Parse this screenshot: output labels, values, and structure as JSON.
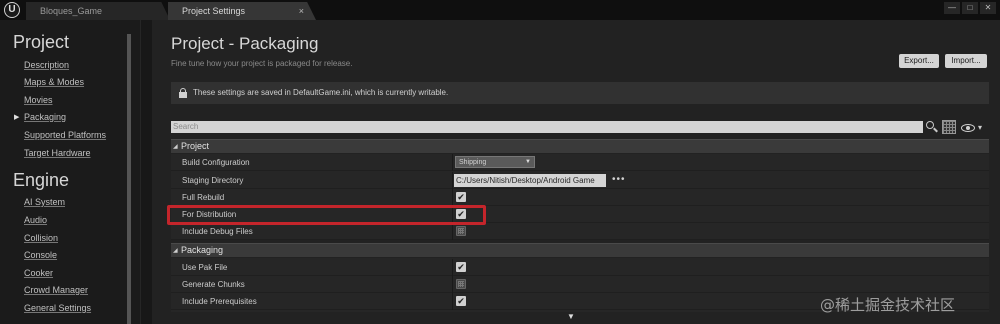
{
  "window": {
    "logo": "U",
    "tabs": [
      {
        "label": "Bloques_Game"
      },
      {
        "label": "Project Settings",
        "close": "×"
      }
    ],
    "controls": {
      "minimize": "—",
      "maximize": "□",
      "close": "✕"
    }
  },
  "sidebar": {
    "project_title": "Project",
    "project_items": [
      {
        "label": "Description"
      },
      {
        "label": "Maps & Modes"
      },
      {
        "label": "Movies"
      },
      {
        "label": "Packaging",
        "selected_marker": "▶"
      },
      {
        "label": "Supported Platforms"
      },
      {
        "label": "Target Hardware"
      }
    ],
    "engine_title": "Engine",
    "engine_items": [
      {
        "label": "AI System"
      },
      {
        "label": "Audio"
      },
      {
        "label": "Collision"
      },
      {
        "label": "Console"
      },
      {
        "label": "Cooker"
      },
      {
        "label": "Crowd Manager"
      },
      {
        "label": "General Settings"
      }
    ]
  },
  "main": {
    "title": "Project - Packaging",
    "subtitle": "Fine tune how your project is packaged for release.",
    "export_button": "Export...",
    "import_button": "Import...",
    "notice": "These settings are saved in DefaultGame.ini, which is currently writable.",
    "search_placeholder": "Search",
    "view_options_chevron": "▾",
    "categories": {
      "project": {
        "label": "Project",
        "arrow": "◢",
        "rows": {
          "build_configuration": {
            "label": "Build Configuration",
            "value": "Shipping",
            "arrow": "▼"
          },
          "staging_directory": {
            "label": "Staging Directory",
            "value": "C:/Users/Nitish/Desktop/Android Game",
            "browse": "•••"
          },
          "full_rebuild": {
            "label": "Full Rebuild",
            "checked": true,
            "mark": "✔"
          },
          "for_distribution": {
            "label": "For Distribution",
            "checked": true,
            "mark": "✔"
          },
          "include_debug_files": {
            "label": "Include Debug Files",
            "checked": false
          }
        }
      },
      "packaging": {
        "label": "Packaging",
        "arrow": "◢",
        "rows": {
          "use_pak_file": {
            "label": "Use Pak File",
            "checked": true,
            "mark": "✔"
          },
          "generate_chunks": {
            "label": "Generate Chunks",
            "checked": false
          },
          "include_prerequisites": {
            "label": "Include Prerequisites",
            "checked": true,
            "mark": "✔"
          }
        }
      }
    },
    "scroll_more_arrow": "▼"
  },
  "watermark": "@稀土掘金技术社区",
  "colors": {
    "highlight": "#c4252b",
    "background": "#222222",
    "sidebar": "#1b1b1b"
  }
}
